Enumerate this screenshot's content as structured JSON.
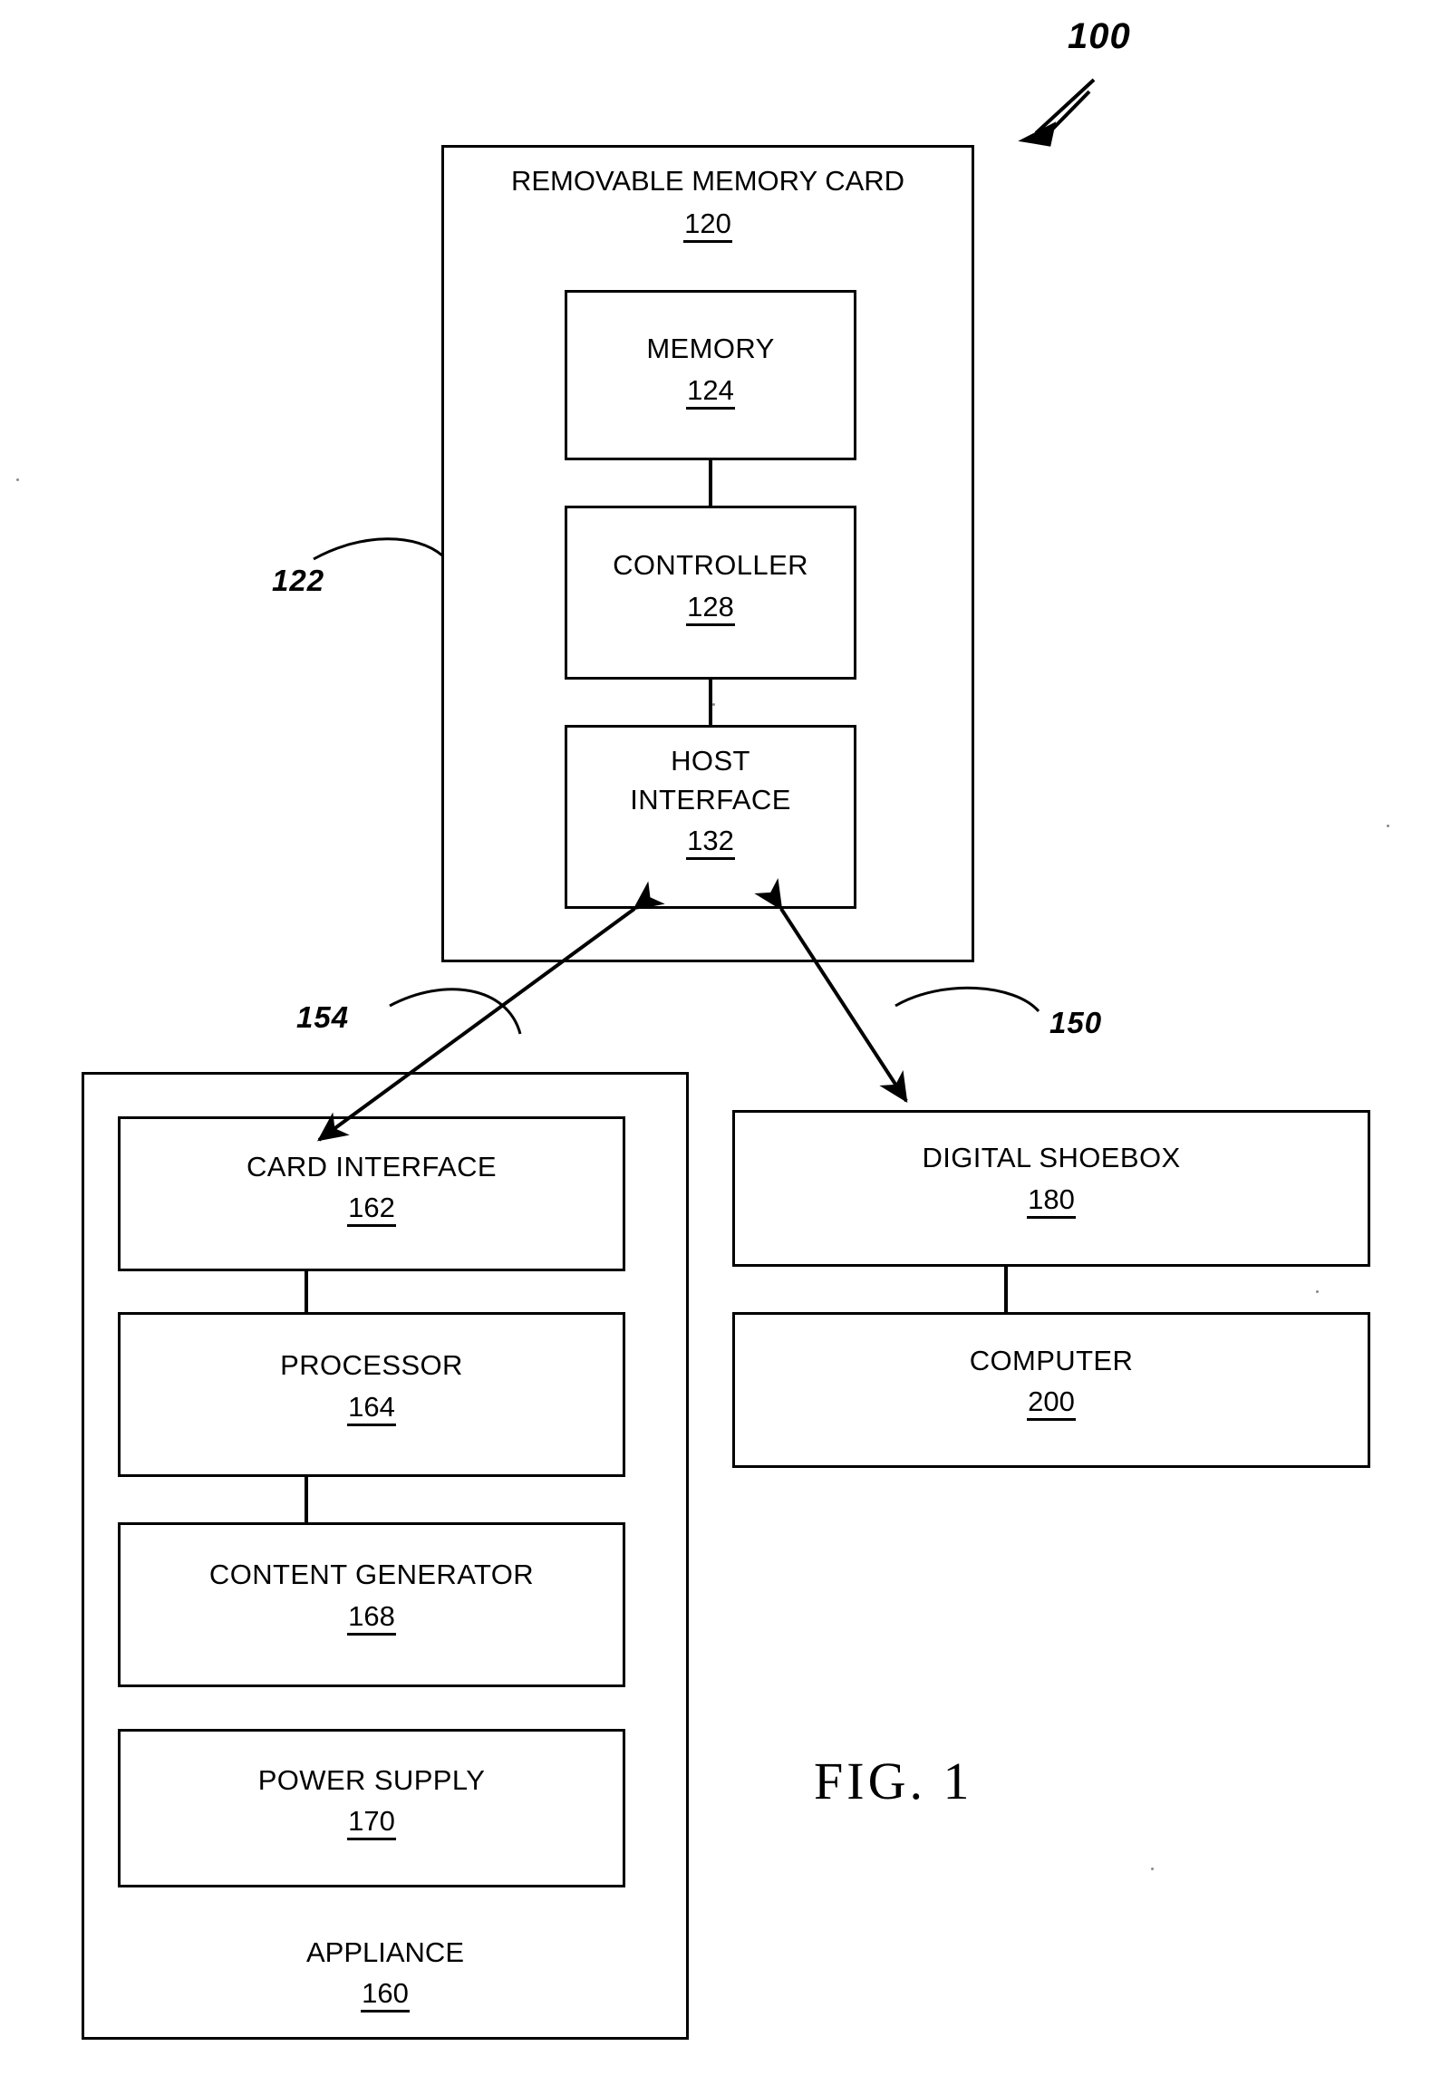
{
  "figure": {
    "caption": "FIG. 1",
    "system_ref": "100"
  },
  "blocks": {
    "removable_memory_card": {
      "title": "REMOVABLE MEMORY CARD",
      "ref": "120",
      "lead_ref": "122"
    },
    "memory": {
      "title": "MEMORY",
      "ref": "124"
    },
    "controller": {
      "title": "CONTROLLER",
      "ref": "128"
    },
    "host_interface": {
      "title_line1": "HOST",
      "title_line2": "INTERFACE",
      "ref": "132"
    },
    "appliance": {
      "title": "APPLIANCE",
      "ref": "160"
    },
    "card_interface": {
      "title": "CARD INTERFACE",
      "ref": "162"
    },
    "processor": {
      "title": "PROCESSOR",
      "ref": "164"
    },
    "content_generator": {
      "title": "CONTENT GENERATOR",
      "ref": "168"
    },
    "power_supply": {
      "title": "POWER SUPPLY",
      "ref": "170"
    },
    "digital_shoebox": {
      "title": "DIGITAL SHOEBOX",
      "ref": "180"
    },
    "computer": {
      "title": "COMPUTER",
      "ref": "200"
    }
  },
  "connections": {
    "appliance_link_ref": "154",
    "shoebox_link_ref": "150"
  }
}
